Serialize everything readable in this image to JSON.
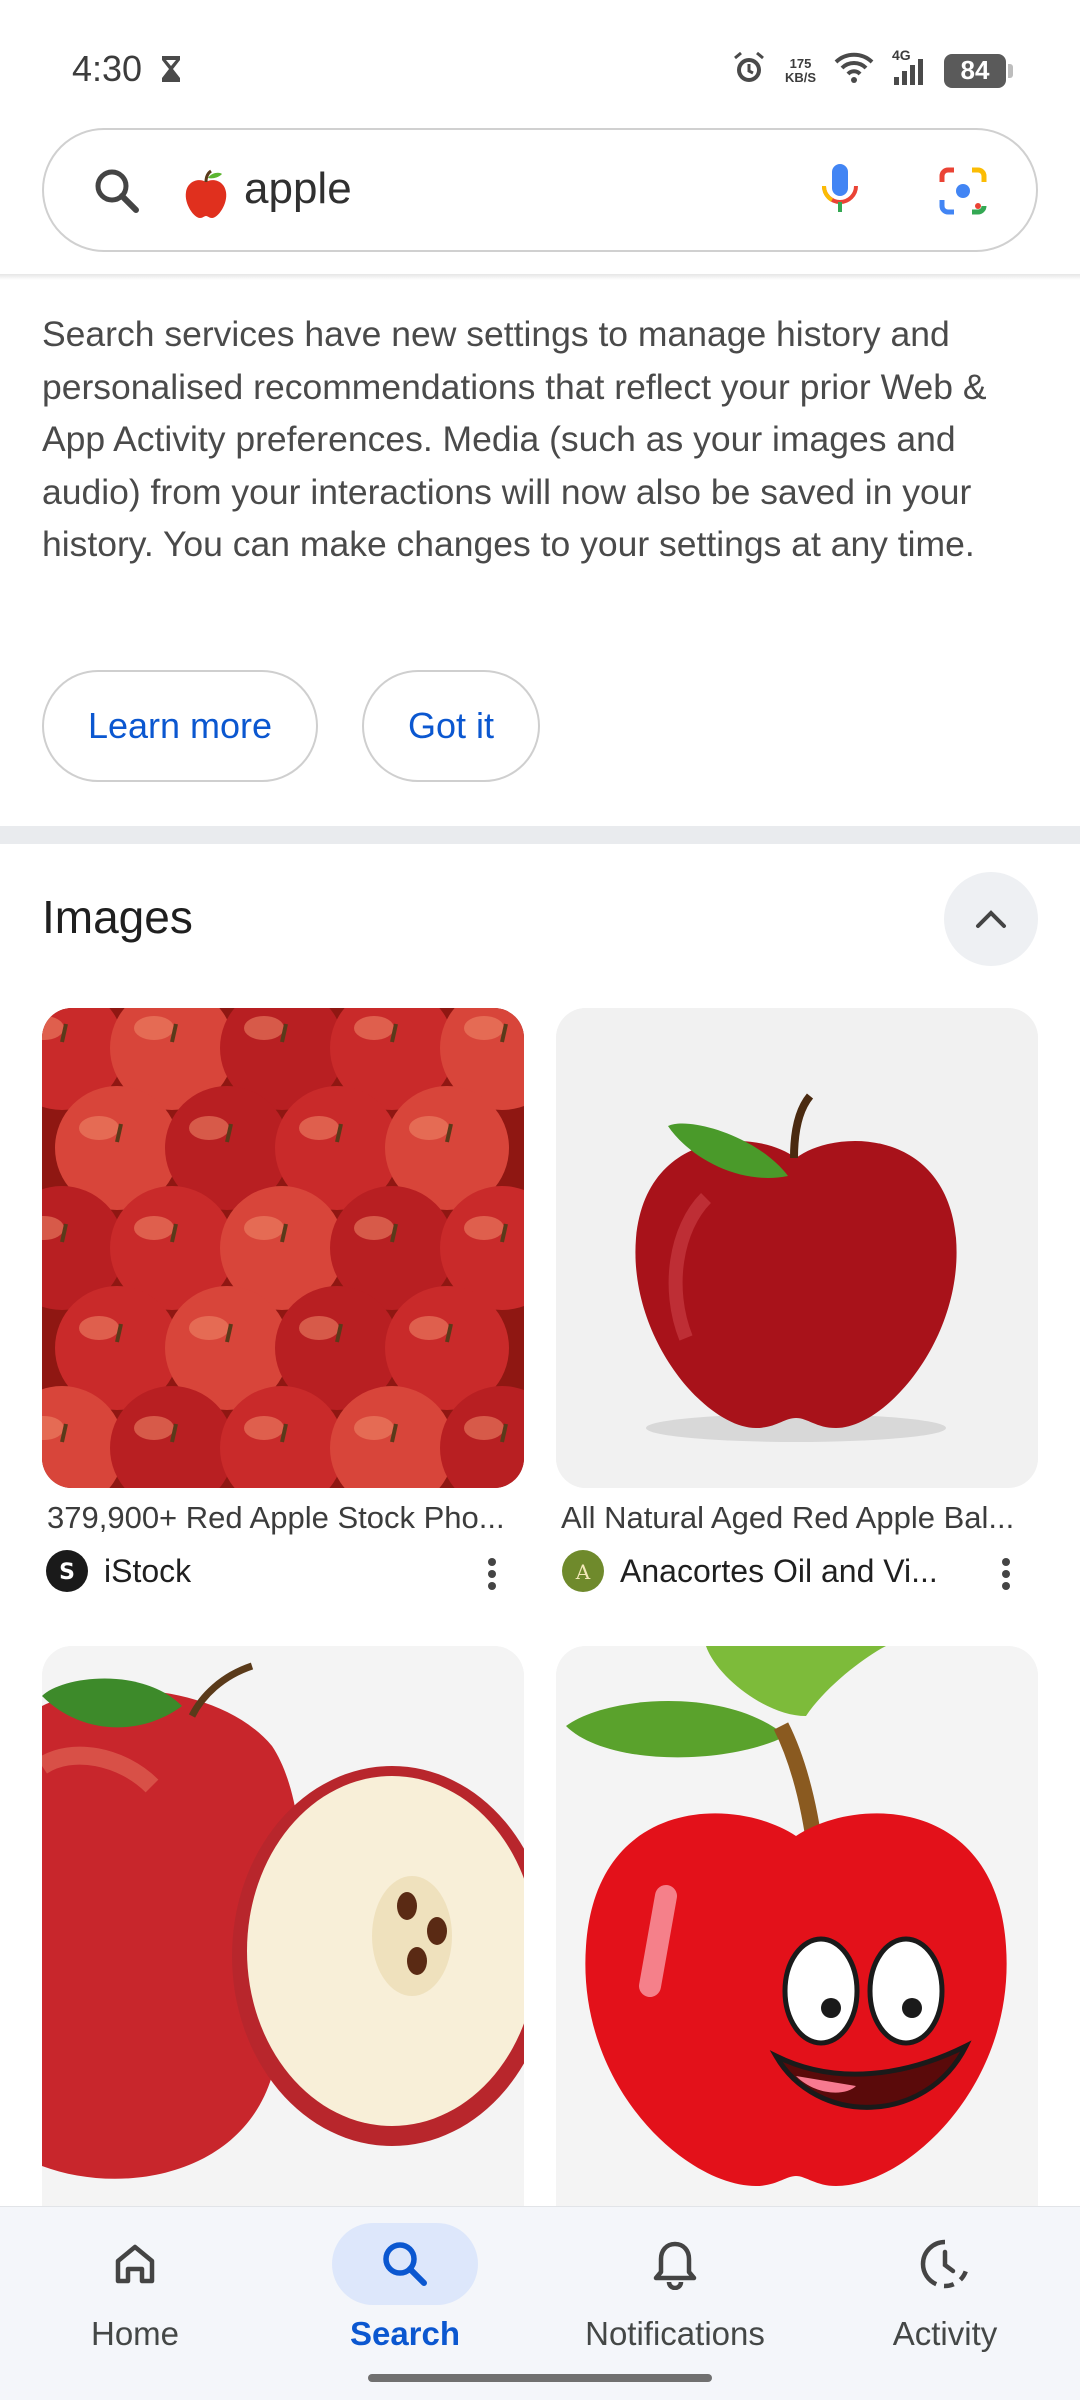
{
  "status_bar": {
    "time": "4:30",
    "net_speed_value": "175",
    "net_speed_unit": "KB/S",
    "network_type": "4G",
    "battery": "84"
  },
  "search": {
    "query": "apple",
    "icons": [
      "search-icon",
      "apple-emoji",
      "mic-icon",
      "lens-icon"
    ]
  },
  "notice": {
    "text": "Search services have new settings to manage history and personalised recommendations that reflect your prior Web & App Activity preferences. Media (such as your images and audio) from your interactions will now also be saved in your history. You can make changes to your settings at any time.",
    "learn_more": "Learn more",
    "got_it": "Got it"
  },
  "images_section": {
    "heading": "Images",
    "results": [
      {
        "caption": "379,900+ Red Apple Stock Pho...",
        "source": "iStock"
      },
      {
        "caption": "All Natural Aged Red Apple Bal...",
        "source": "Anacortes Oil and Vi..."
      },
      {
        "caption": "",
        "source": ""
      },
      {
        "caption": "",
        "source": ""
      }
    ]
  },
  "bottom_nav": {
    "items": [
      {
        "label": "Home",
        "icon": "home-icon"
      },
      {
        "label": "Search",
        "icon": "search-icon",
        "active": true
      },
      {
        "label": "Notifications",
        "icon": "bell-icon"
      },
      {
        "label": "Activity",
        "icon": "activity-icon"
      }
    ]
  },
  "colors": {
    "accent": "#0b57d0",
    "active_tab_bg": "#dde7fb",
    "nav_bg": "#f4f6fa"
  }
}
